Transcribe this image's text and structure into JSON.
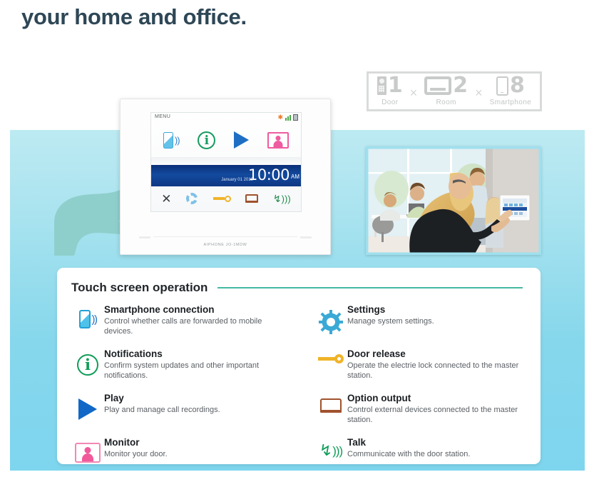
{
  "headline": "your home and office.",
  "capacity": {
    "items": [
      {
        "icon": "door-station-icon",
        "count": "1",
        "label": "Door"
      },
      {
        "icon": "room-monitor-icon",
        "count": "2",
        "label": "Room"
      },
      {
        "icon": "smartphone-icon",
        "count": "8",
        "label": "Smartphone"
      }
    ],
    "separator": "×"
  },
  "device": {
    "screen": {
      "menu_label": "MENU",
      "status_icons": [
        "asterisk-icon",
        "signal-bars-icon",
        "sd-card-icon"
      ],
      "main_icons": [
        "smartphone-connection-icon",
        "notifications-icon",
        "play-icon",
        "monitor-icon"
      ],
      "date": "January 01 2019",
      "time": "10:00",
      "ampm": "AM",
      "bottom_icons": [
        "close-icon",
        "settings-gear-icon",
        "door-release-key-icon",
        "option-output-icon",
        "talk-icon"
      ]
    },
    "brand": "AIPHONE JO-1MDW"
  },
  "card": {
    "title": "Touch screen operation",
    "accent_color": "#46b8a2",
    "features_left": [
      {
        "icon": "smartphone-connection-icon",
        "title": "Smartphone connection",
        "desc": "Control whether calls are forwarded to mobile devices."
      },
      {
        "icon": "notifications-info-icon",
        "title": "Notifications",
        "desc": "Confirm system updates and other important notifications."
      },
      {
        "icon": "play-icon",
        "title": "Play",
        "desc": "Play and manage call recordings."
      },
      {
        "icon": "monitor-icon",
        "title": "Monitor",
        "desc": "Monitor your door."
      }
    ],
    "features_right": [
      {
        "icon": "settings-gear-icon",
        "title": "Settings",
        "desc": "Manage system settings."
      },
      {
        "icon": "door-release-key-icon",
        "title": "Door release",
        "desc": "Operate the electrie lock connected to the master station."
      },
      {
        "icon": "option-output-icon",
        "title": "Option output",
        "desc": "Control external devices connected to the master station."
      },
      {
        "icon": "talk-icon",
        "title": "Talk",
        "desc": "Communicate with the door station."
      }
    ]
  },
  "colors": {
    "panel_top": "#bdeaf2",
    "panel_bottom": "#7ed6ee",
    "headline": "#2e4756",
    "accent_teal": "#46b8a2",
    "hand": "#8fcfcb"
  }
}
